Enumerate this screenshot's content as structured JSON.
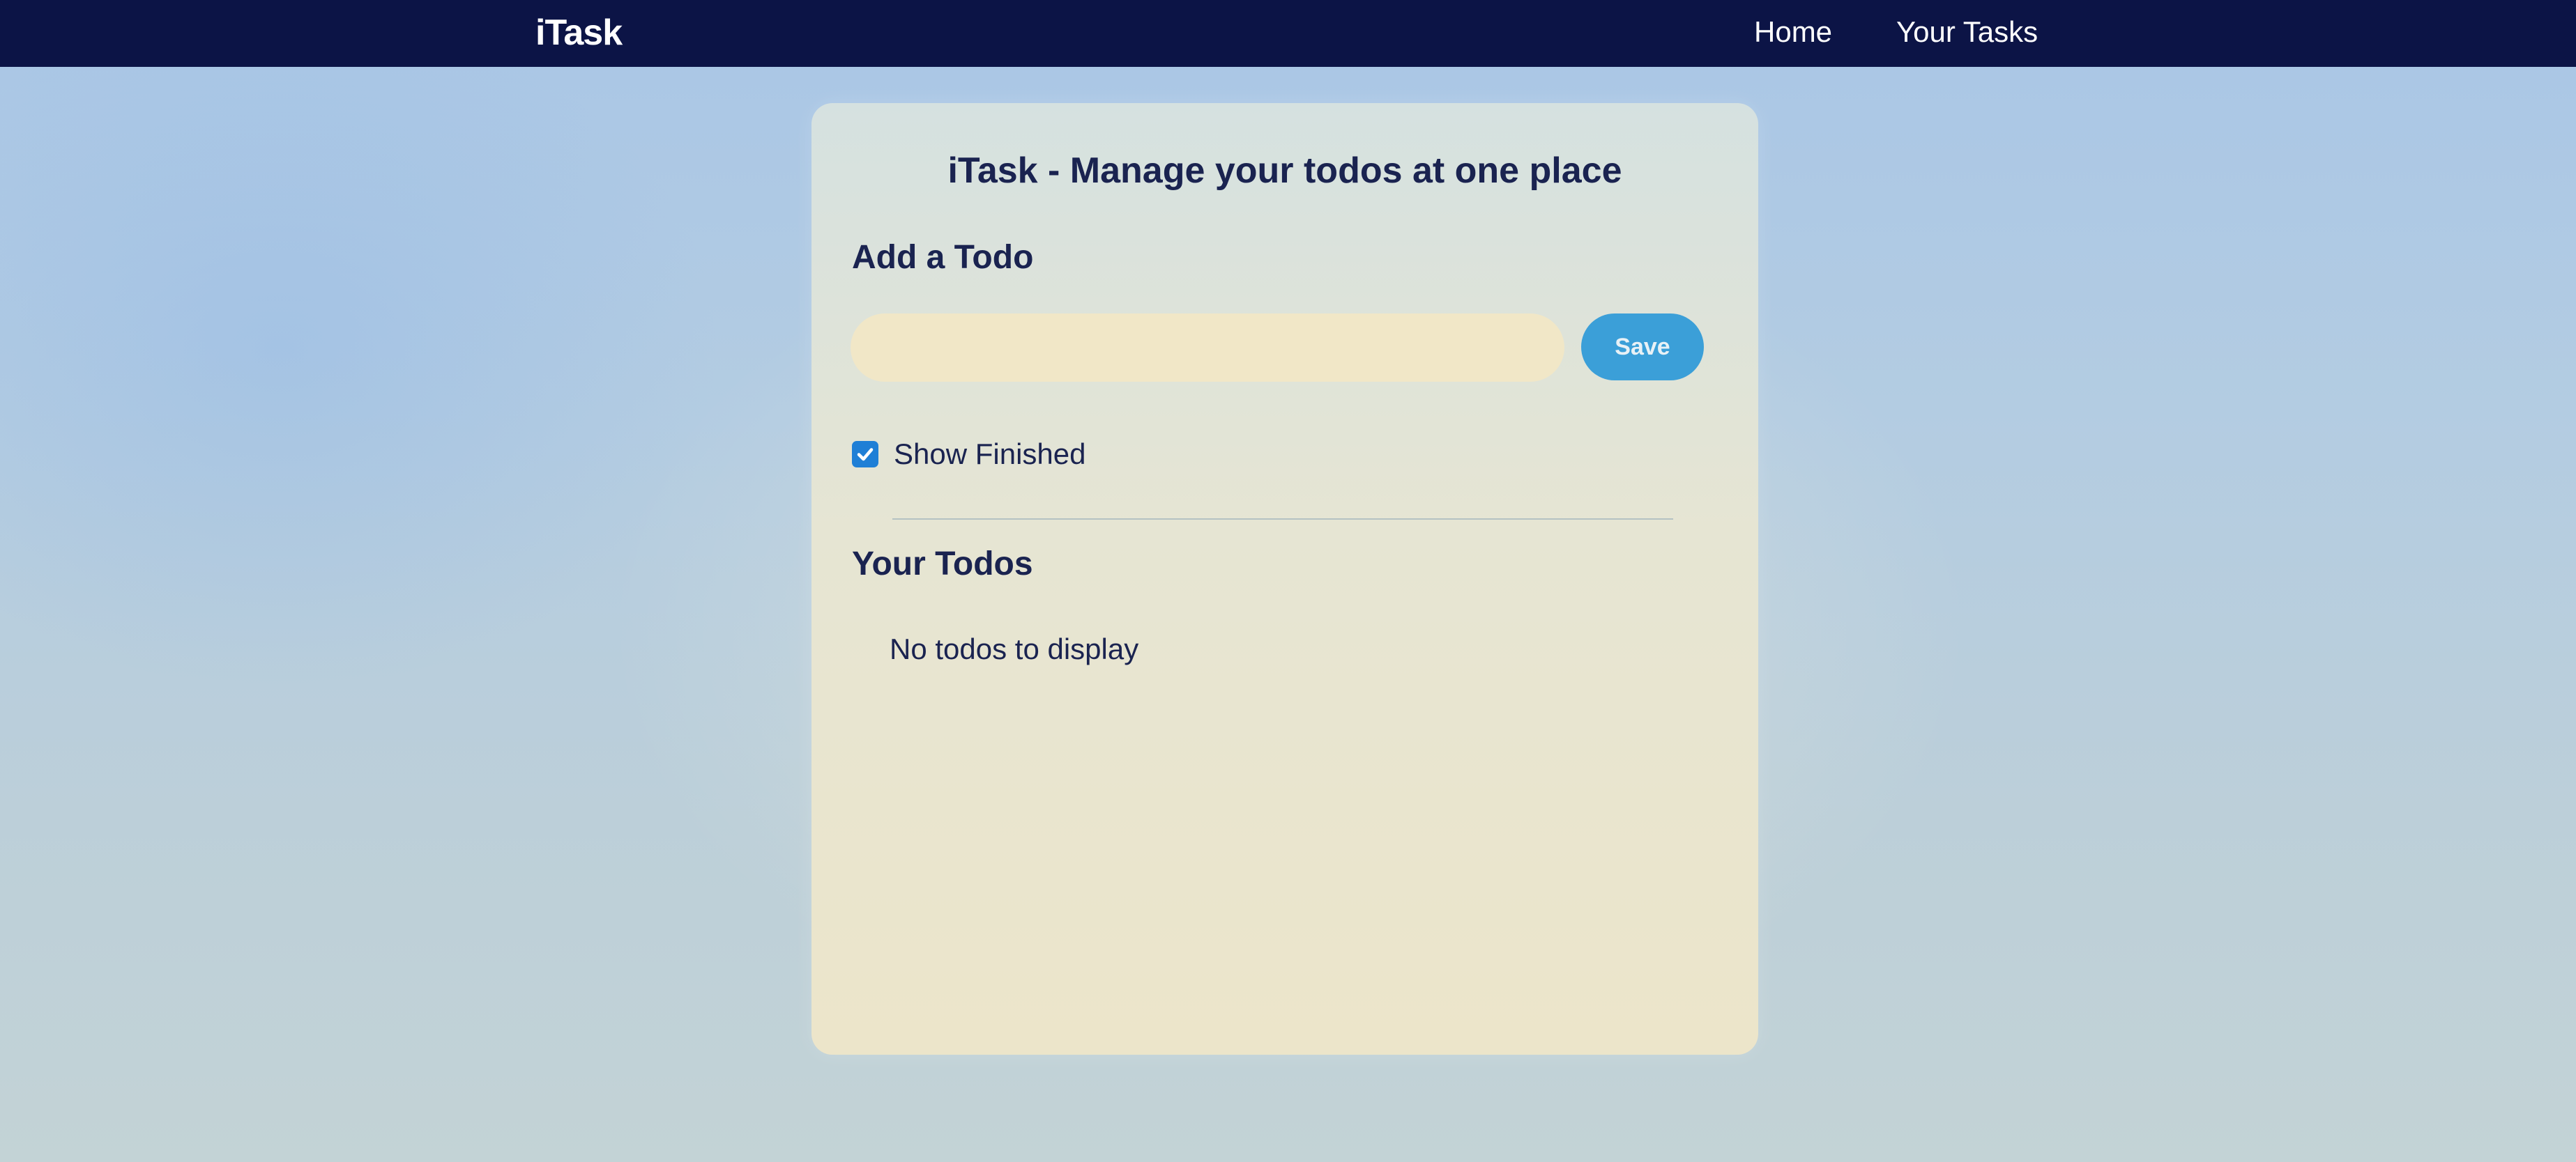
{
  "navbar": {
    "brand": "iTask",
    "links": [
      "Home",
      "Your Tasks"
    ]
  },
  "card": {
    "title": "iTask - Manage your todos at one place",
    "add_heading": "Add a Todo",
    "input": {
      "value": "",
      "placeholder": ""
    },
    "save_label": "Save",
    "show_finished": {
      "label": "Show Finished",
      "checked": true
    },
    "todos_heading": "Your Todos",
    "empty_message": "No todos to display"
  },
  "colors": {
    "navbar": "#0c1446",
    "accent": "#3b9fd8",
    "checkbox": "#1f7fd6",
    "text": "#1a2350"
  }
}
